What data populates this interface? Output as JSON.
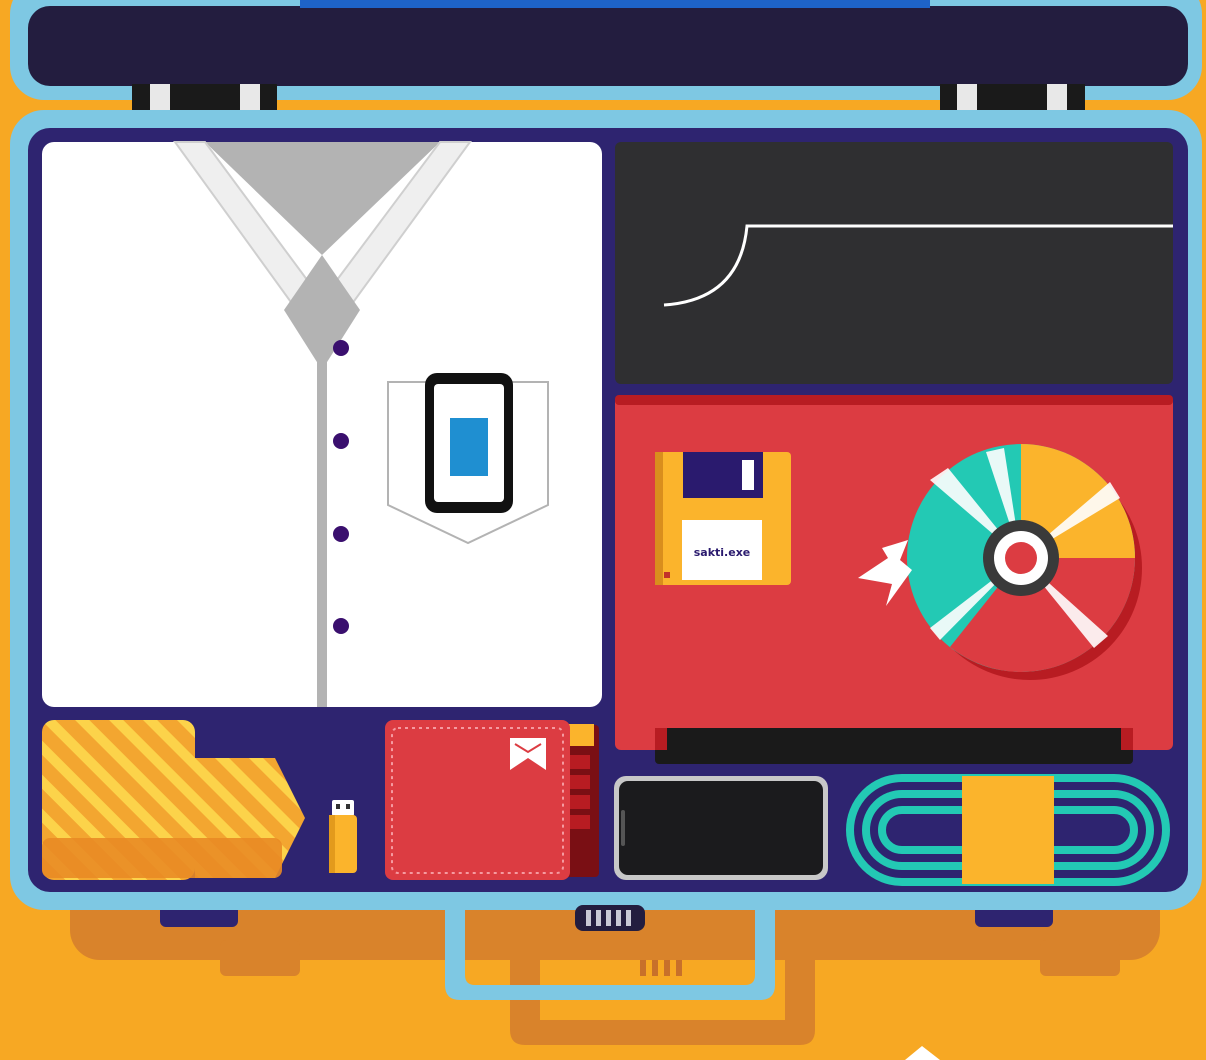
{
  "floppy_disk": {
    "label": "sakti.exe"
  },
  "colors": {
    "background": "#f7a823",
    "suitcase_frame": "#7ec8e3",
    "suitcase_interior": "#2e2470",
    "lid": "#231d3f",
    "shirt": "#ffffff",
    "collar": "#b3b3b3",
    "laptop_screen": "#2f2f31",
    "laptop_body": "#dc3c42",
    "floppy": "#fbb42c",
    "disc_teal": "#23c9b4",
    "disc_yellow": "#fbb42c",
    "tie": "#f3a630",
    "cable": "#23c9b4",
    "wallet": "#dc3c42",
    "phone": "#1b1b1d"
  },
  "icons": [
    "suitcase-icon",
    "shirt-icon",
    "smartphone-icon",
    "laptop-icon",
    "floppy-disk-icon",
    "compact-disc-icon",
    "necktie-icon",
    "usb-drive-icon",
    "wallet-icon",
    "power-bank-icon",
    "cable-icon"
  ]
}
